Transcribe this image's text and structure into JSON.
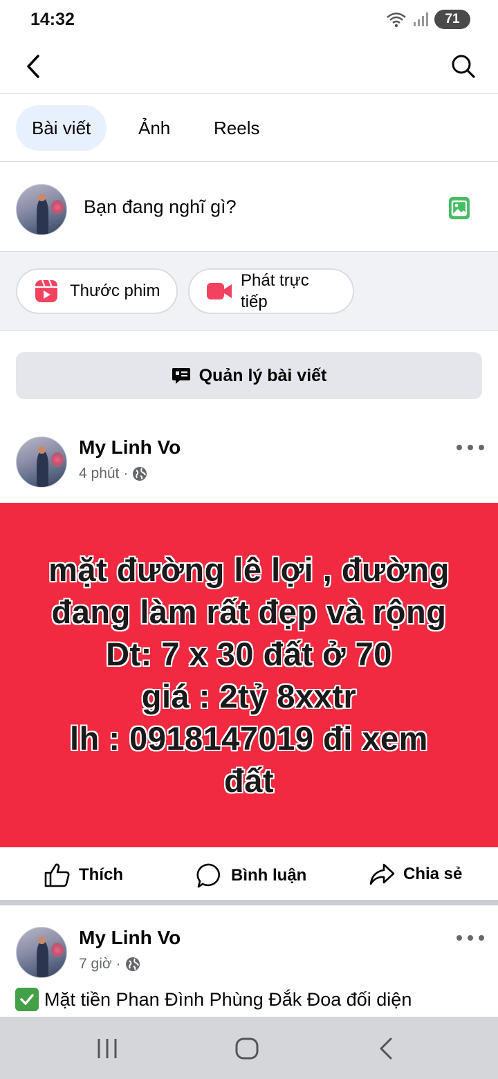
{
  "status_bar": {
    "time": "14:32",
    "battery": "71"
  },
  "tabs": [
    {
      "label": "Bài viết",
      "active": true
    },
    {
      "label": "Ảnh",
      "active": false
    },
    {
      "label": "Reels",
      "active": false
    }
  ],
  "composer": {
    "placeholder": "Bạn đang nghĩ gì?"
  },
  "actions": [
    {
      "label": "Thước phim",
      "icon": "reels-icon"
    },
    {
      "label": "Phát trực\ntiếp",
      "icon": "live-video-icon"
    }
  ],
  "manage_posts": {
    "label": "Quản lý bài viết"
  },
  "post1": {
    "author": "My Linh Vo",
    "time": "4 phút",
    "separator": "·",
    "banner_text": "mặt đường lê lợi , đường\nđang làm rất đẹp và rộng\nDt: 7 x 30 đất ở 70\ngiá : 2tỷ 8xxtr\nlh : 0918147019 đi xem\nđất",
    "banner_color": "#f22a41"
  },
  "reactions": {
    "like": "Thích",
    "comment": "Bình luận",
    "share": "Chia sẻ"
  },
  "post2": {
    "author": "My Linh Vo",
    "time": "7 giờ",
    "separator": "·",
    "text": "Mặt tiền Phan Đình Phùng Đắk Đoa đối diện"
  },
  "colors": {
    "accent": "#1877f2",
    "tab_active_bg": "#e7f0fd",
    "green": "#45bd62",
    "red": "#f3425f"
  }
}
